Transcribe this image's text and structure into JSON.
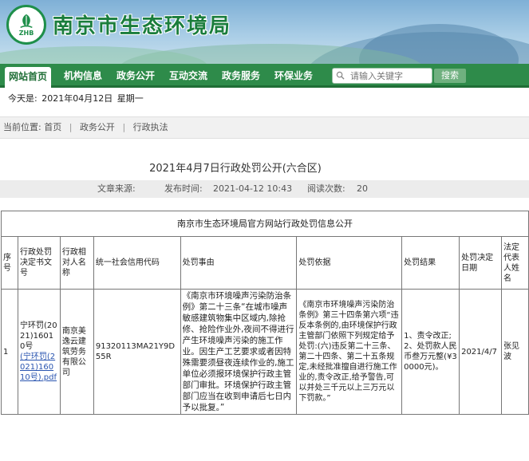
{
  "header": {
    "site_title": "南京市生态环境局",
    "logo_text": "ZHB"
  },
  "nav": {
    "items": [
      "网站首页",
      "机构信息",
      "政务公开",
      "互动交流",
      "政务服务",
      "环保业务"
    ],
    "search_placeholder": "请输入关键字",
    "search_button": "搜索"
  },
  "datebar": {
    "label": "今天是:",
    "date": "2021年04月12日",
    "weekday": "星期一"
  },
  "breadcrumb": {
    "label": "当前位置:",
    "items": [
      "首页",
      "政务公开",
      "行政执法"
    ]
  },
  "article": {
    "title": "2021年4月7日行政处罚公开(六合区)",
    "source_label": "文章来源:",
    "source_value": "",
    "publish_label": "发布时间:",
    "publish_time": "2021-04-12 10:43",
    "views_label": "阅读次数:",
    "views": "20"
  },
  "table": {
    "caption": "南京市生态环境局官方网站行政处罚信息公开",
    "headers": [
      "序号",
      "行政处罚决定书文号",
      "行政相对人名称",
      "统一社会信用代码",
      "处罚事由",
      "处罚依据",
      "处罚结果",
      "处罚决定日期",
      "法定代表人姓名"
    ],
    "rows": [
      {
        "index": "1",
        "doc_no": "宁环罚(2021)16010号",
        "doc_link": "(宁环罚(2021)16010号).pdf",
        "party": "南京美逸云建筑劳务有限公司",
        "credit_code": "91320113MA21Y9D55R",
        "reason": "《南京市环境噪声污染防治条例》第二十三条“在城市噪声敏感建筑物集中区域内,除抢修、抢险作业外,夜间不得进行产生环境噪声污染的施工作业。因生产工艺要求或者因特殊需要须昼夜连续作业的,施工单位必须报环境保护行政主管部门审批。环境保护行政主管部门应当在收到申请后七日内予以批复。”",
        "basis": "《南京市环境噪声污染防治条例》第三十四条第六项“违反本条例的,由环境保护行政主管部门依照下列规定给予处罚:(六)违反第二十三条、第二十四条、第二十五条规定,未经批准擅自进行施工作业的,责令改正,给予警告,可以并处三千元以上三万元以下罚款。”",
        "result": "1、责令改正;2、处罚款人民币叁万元整(¥30000元)。",
        "date": "2021/4/7",
        "legal_rep": "张见波"
      }
    ]
  }
}
